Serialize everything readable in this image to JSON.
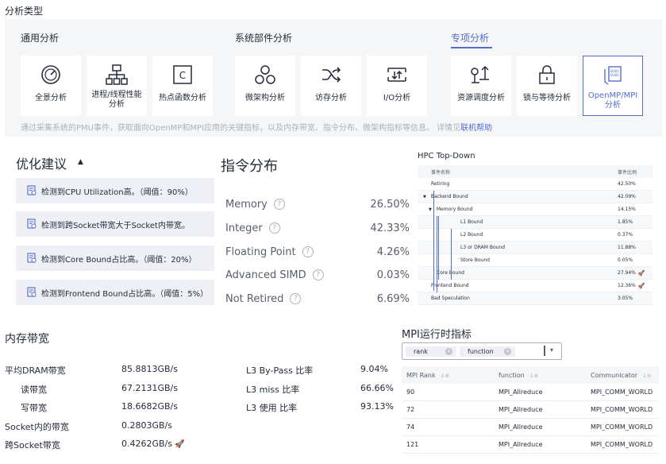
{
  "page_title": "分析类型",
  "groups": {
    "general": "通用分析",
    "system": "系统部件分析",
    "special": "专项分析"
  },
  "cards": [
    {
      "label": "全景分析",
      "icon": "gauge-icon"
    },
    {
      "label": "进程/线程性能分析",
      "icon": "hierarchy-icon"
    },
    {
      "label": "热点函数分析",
      "icon": "function-c-icon"
    },
    {
      "label": "微架构分析",
      "icon": "nodes-icon"
    },
    {
      "label": "访存分析",
      "icon": "shuffle-icon"
    },
    {
      "label": "I/O分析",
      "icon": "io-icon"
    },
    {
      "label": "资源调度分析",
      "icon": "scheduling-icon"
    },
    {
      "label": "锁与等待分析",
      "icon": "lock-icon"
    },
    {
      "label": "OpenMP/MPI分析",
      "icon": "openmp-mpi-icon",
      "selected": true
    }
  ],
  "panel_desc": "通过采集系统的PMU事件，获取面向OpenMP和MPI应用的关键指标，以及内存带宽、指令分布、微架构指标等信息。 详情见",
  "panel_link": "联机帮助",
  "optimization": {
    "title": "优化建议",
    "items": [
      "检测到CPU Utilization高。（阈值：90%）",
      "检测到跨Socket带宽大于Socket内带宽。",
      "检测到Core Bound占比高。（阈值：20%）",
      "检测到Frontend Bound占比高。（阈值：5%）"
    ]
  },
  "instructions": {
    "title": "指令分布",
    "rows": [
      {
        "name": "Memory",
        "value": "26.50%"
      },
      {
        "name": "Integer",
        "value": "42.33%"
      },
      {
        "name": "Floating Point",
        "value": "4.26%"
      },
      {
        "name": "Advanced SIMD",
        "value": "0.03%"
      },
      {
        "name": "Not Retired",
        "value": "6.69%"
      }
    ]
  },
  "hpc": {
    "title": "HPC Top-Down",
    "col_name": "事件名称",
    "col_ratio": "事件比例",
    "rows": [
      {
        "name": "Retiring",
        "value": "42.50%",
        "level": 0,
        "expand": false
      },
      {
        "name": "Backend Bound",
        "value": "42.09%",
        "level": 0,
        "expand": true
      },
      {
        "name": "Memory Bound",
        "value": "14.15%",
        "level": 1,
        "expand": true
      },
      {
        "name": "L1 Bound",
        "value": "1.85%",
        "level": 2,
        "expand": false
      },
      {
        "name": "L2 Bound",
        "value": "0.37%",
        "level": 2,
        "expand": false
      },
      {
        "name": "L3 or DRAM Bound",
        "value": "11.88%",
        "level": 2,
        "expand": false
      },
      {
        "name": "Store Bound",
        "value": "0.05%",
        "level": 2,
        "expand": false
      },
      {
        "name": "Core Bound",
        "value": "27.94%",
        "level": 1,
        "expand": false,
        "alert": true
      },
      {
        "name": "Frontend Bound",
        "value": "12.36%",
        "level": 0,
        "expand": false,
        "alert": true
      },
      {
        "name": "Bad Speculation",
        "value": "3.05%",
        "level": 0,
        "expand": false
      }
    ]
  },
  "memory": {
    "title": "内存带宽",
    "left": [
      {
        "label": "平均DRAM带宽",
        "value": "85.8813GB/s",
        "indent": false
      },
      {
        "label": "读带宽",
        "value": "67.2131GB/s",
        "indent": true
      },
      {
        "label": "写带宽",
        "value": "18.6682GB/s",
        "indent": true
      },
      {
        "label": "Socket内的带宽",
        "value": "0.2803GB/s",
        "indent": false
      },
      {
        "label": "跨Socket带宽",
        "value": "0.4262GB/s",
        "indent": false,
        "alert": true
      }
    ],
    "right": [
      {
        "label": "L3 By-Pass 比率",
        "value": "9.04%"
      },
      {
        "label": "L3 miss 比率",
        "value": "66.66%"
      },
      {
        "label": "L3 使用 比率",
        "value": "93.13%"
      }
    ]
  },
  "mpi": {
    "title": "MPI运行时指标",
    "tags": [
      "rank",
      "function"
    ],
    "columns": [
      "MPI Rank",
      "function",
      "Communicator"
    ],
    "rows": [
      [
        "90",
        "MPI_Allreduce",
        "MPI_COMM_WORLD"
      ],
      [
        "72",
        "MPI_Allreduce",
        "MPI_COMM_WORLD"
      ],
      [
        "74",
        "MPI_Allreduce",
        "MPI_COMM_WORLD"
      ],
      [
        "121",
        "MPI_Allreduce",
        "MPI_COMM_WORLD"
      ]
    ]
  },
  "colors": {
    "accent": "#526ecc",
    "alert": "#e54545"
  }
}
